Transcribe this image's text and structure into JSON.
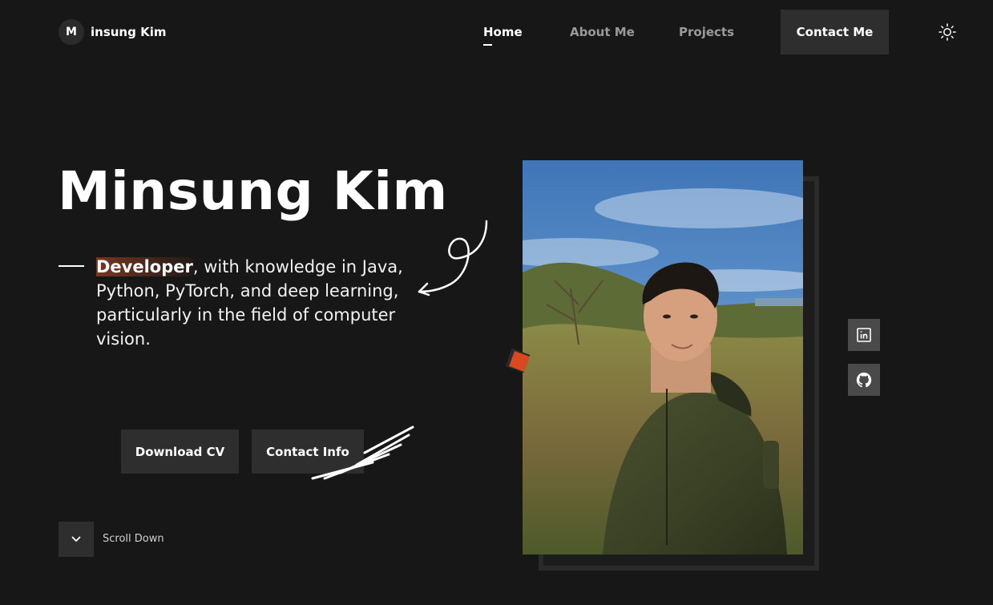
{
  "header": {
    "logo_letter": "M",
    "logo_name": "insung Kim",
    "nav": [
      {
        "label": "Home",
        "active": true
      },
      {
        "label": "About Me",
        "active": false
      },
      {
        "label": "Projects",
        "active": false
      }
    ],
    "contact_label": "Contact Me",
    "theme_icon": "sun-icon"
  },
  "hero": {
    "title": "Minsung Kim",
    "role": "Developer",
    "tagline_rest": ", with knowledge in Java, Python, PyTorch, and deep learning, particularly in the field of computer vision.",
    "buttons": {
      "download_cv": "Download CV",
      "contact_info": "Contact Info"
    },
    "scroll_label": "Scroll Down"
  },
  "social": [
    {
      "icon": "linkedin-icon"
    },
    {
      "icon": "github-icon"
    }
  ],
  "colors": {
    "background": "#171717",
    "button": "#2e2e2e",
    "accent": "#d9481f",
    "nav_inactive": "#9a9a9a"
  }
}
